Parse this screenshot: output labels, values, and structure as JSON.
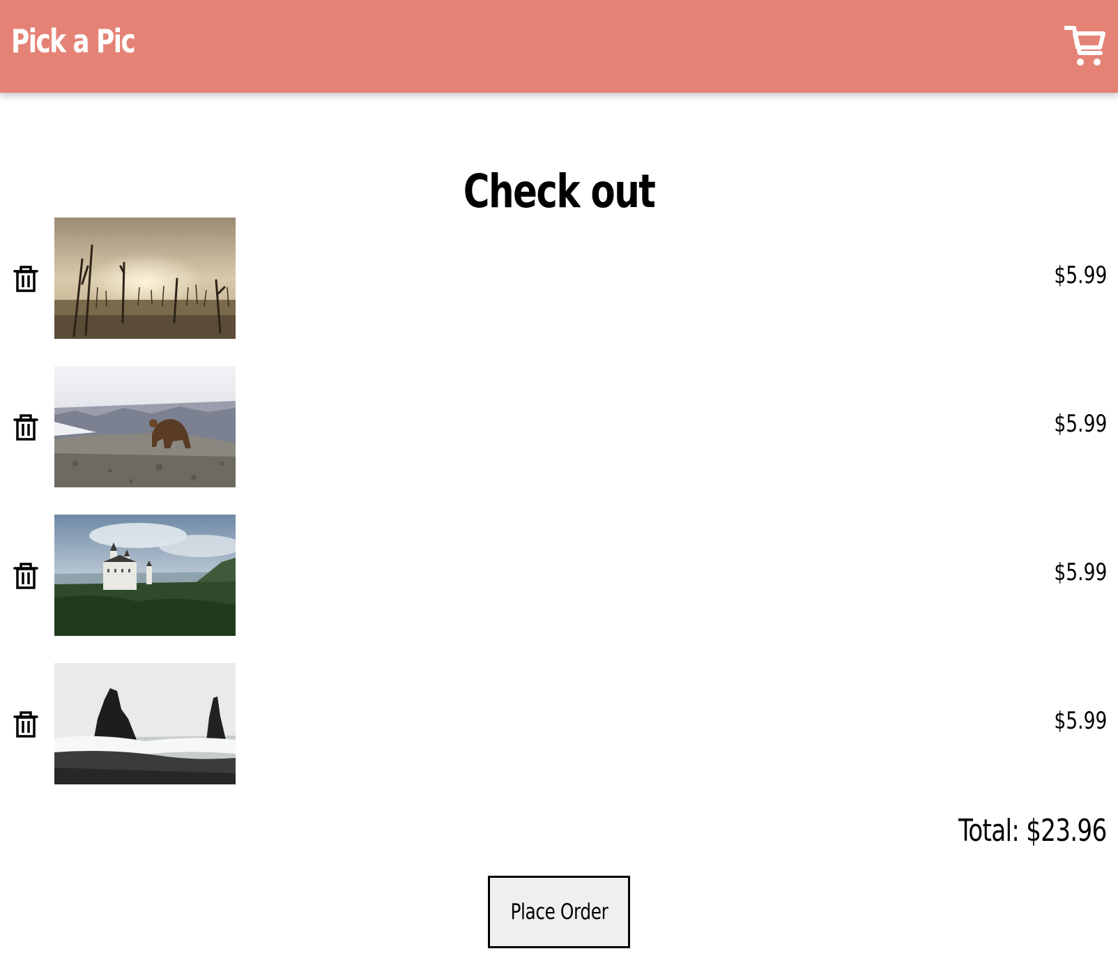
{
  "header": {
    "brand": "Pick a Pic",
    "cart_icon": "shopping-cart-icon",
    "bar_color": "#e58276"
  },
  "page": {
    "title": "Check out"
  },
  "items": [
    {
      "image": "dead forest landscape",
      "price": "$5.99",
      "delete_icon": "trash-icon"
    },
    {
      "image": "bear on rocky hill",
      "price": "$5.99",
      "delete_icon": "trash-icon"
    },
    {
      "image": "castle above forest",
      "price": "$5.99",
      "delete_icon": "trash-icon"
    },
    {
      "image": "sea stacks on beach",
      "price": "$5.99",
      "delete_icon": "trash-icon"
    }
  ],
  "summary": {
    "total": "Total: $23.96"
  },
  "actions": {
    "place_order": "Place Order"
  }
}
